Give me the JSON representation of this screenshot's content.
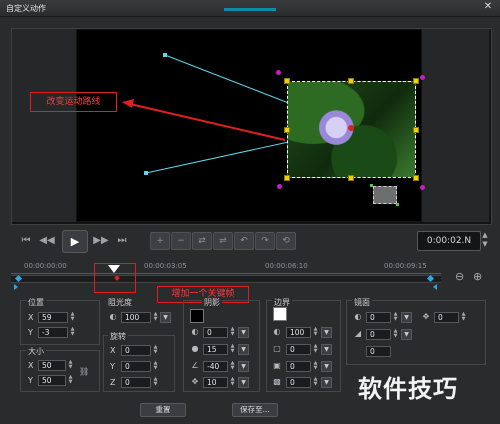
{
  "window": {
    "title": "自定义动作",
    "close_glyph": "✕"
  },
  "annotations": {
    "motion_path_label": "改变运动路线",
    "keyframe_label": "增加一个关键帧"
  },
  "transport": {
    "first_glyph": "⏮",
    "prev_glyph": "◀◀",
    "play_glyph": "▶",
    "next_glyph": "▶▶",
    "last_glyph": "⏭",
    "timecode": "0:00:02.N",
    "keyframe_tools": [
      "+",
      "−",
      "⇄",
      "⇌",
      "↶",
      "↷",
      "⟲"
    ]
  },
  "timeline": {
    "ticks": [
      "00:00:00:00",
      "00:00:03:05",
      "00:00:06:10",
      "00:00:09:15"
    ],
    "playhead_fraction": 0.24,
    "zoom_out_glyph": "⊖",
    "zoom_in_glyph": "⊕"
  },
  "position": {
    "label": "位置",
    "x_label": "X",
    "x": "59",
    "y_label": "Y",
    "y": "-3"
  },
  "size": {
    "label": "大小",
    "x_label": "X",
    "x": "50",
    "y_label": "Y",
    "y": "50",
    "link_glyph": "⛓"
  },
  "opacity": {
    "label": "阻光度",
    "value": "100"
  },
  "rotation": {
    "label": "旋转",
    "x_label": "X",
    "x": "0",
    "y_label": "Y",
    "y": "0",
    "z_label": "Z",
    "z": "0"
  },
  "shadow": {
    "label": "阴影",
    "swatch_color": "#000000",
    "opacity": "0",
    "blur": "15",
    "angle": "-40",
    "distance": "10"
  },
  "border": {
    "label": "边界",
    "swatch_color": "#ffffff",
    "opacity": "100",
    "v1": "0",
    "v2": "0",
    "v3": "0"
  },
  "reflection": {
    "label": "镜面",
    "v1": "0",
    "v2": "0",
    "v3": "0",
    "v4": "0"
  },
  "buttons": {
    "reset": "重置",
    "save_as": "保存至..."
  },
  "watermark": "软件技巧",
  "colors": {
    "accent": "#0a8ea5",
    "annotation_red": "#e02020",
    "handle_yellow": "#f2d100",
    "path_cyan": "#5fd6e8"
  }
}
